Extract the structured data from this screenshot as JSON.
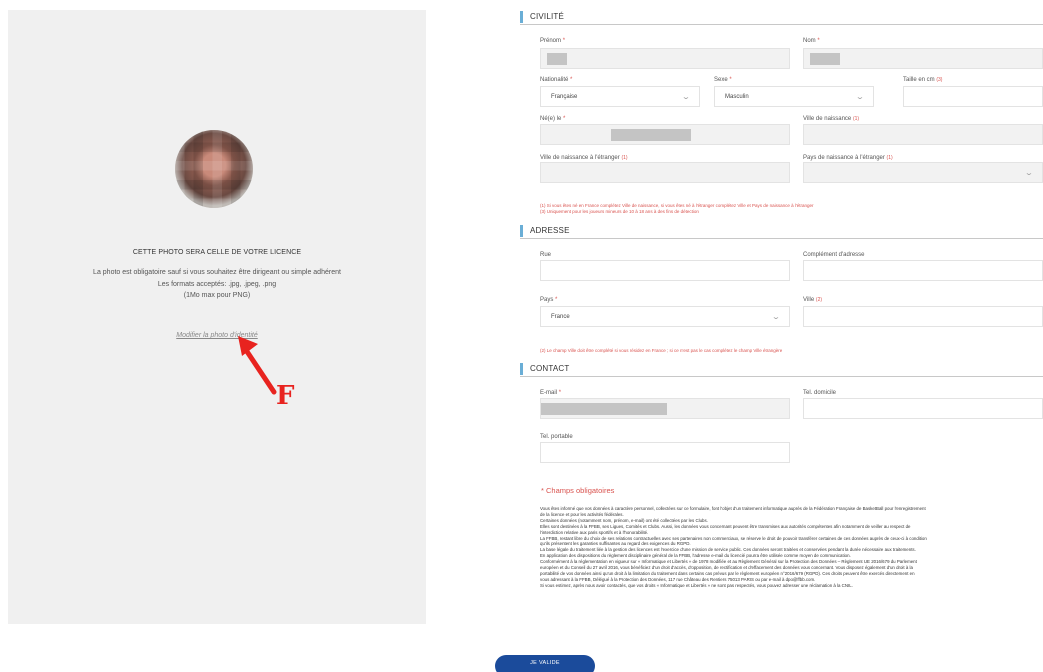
{
  "photo_panel": {
    "title": "CETTE PHOTO SERA CELLE DE VOTRE LICENCE",
    "desc_lines": [
      "La photo est obligatoire sauf si vous souhaitez être dirigeant ou simple adhérent",
      "Les formats acceptés: .jpg, .jpeg, .png",
      "(1Mo max pour PNG)"
    ],
    "link": "Modifier la photo d'identité",
    "annotation_letter": "F",
    "annotation_color": "#e8231f"
  },
  "civilite": {
    "title": "CIVILITÉ",
    "prenom_label": "Prénom",
    "nom_label": "Nom",
    "nationalite_label": "Nationalité",
    "nationalite_value": "Française",
    "sexe_label": "Sexe",
    "sexe_value": "Masculin",
    "taille_label": "Taille en cm",
    "taille_ref": "(3)",
    "ne_le_label": "Né(e) le",
    "ville_naissance_label": "Ville de naissance",
    "ville_naissance_ref": "(1)",
    "ville_etranger_label": "Ville de naissance à l'étranger",
    "ville_etranger_ref": "(1)",
    "pays_etranger_label": "Pays de naissance à l'étranger",
    "pays_etranger_ref": "(1)",
    "notes": [
      "(1) Si vous êtes né en France complétez Ville de naissance, si vous êtes né à l'étranger complétez Ville et Pays de naissance à l'étranger",
      "(3) Uniquement pour les joueurs mineurs de 10 à 18 ans à des fins de détection"
    ]
  },
  "adresse": {
    "title": "ADRESSE",
    "rue_label": "Rue",
    "complement_label": "Complément d'adresse",
    "pays_label": "Pays",
    "pays_value": "France",
    "ville_label": "Ville",
    "ville_ref": "(2)",
    "note": "(2) Le champ Ville doit être complété si vous résidez en France ; si ce n'est pas le cas complétez le champ Ville étrangère"
  },
  "contact": {
    "title": "CONTACT",
    "email_label": "E-mail",
    "tel_domicile_label": "Tel. domicile",
    "tel_portable_label": "Tel. portable"
  },
  "required_note": "* Champs obligatoires",
  "legal_lines": [
    "Vous êtes informé que vos données à caractère personnel, collectées sur ce formulaire, font l'objet d'un traitement informatique auprès de la Fédération Française de BasketBall pour l'enregistrement",
    "de la licence et pour les activités fédérales.",
    "Certaines données (notamment nom, prénom, e-mail) ont été collectées par les Clubs.",
    "Elles sont destinées à la FFBB, ses Ligues, Comités et Clubs. Aussi, les données vous concernant peuvent être transmises aux autorités compétentes afin notamment de veiller au respect de",
    "l'interdiction relative aux paris sportifs et à l'honorabilité.",
    "La FFBB, restant libre du choix de ses relations contractuelles avec ses partenaires non commerciaux, se réserve le droit de pouvoir transférer certaines de ces données auprès de ceux-ci à condition",
    "qu'ils présentent les garanties suffisantes au regard des exigences du RGPD.",
    "La base légale du traitement liée à la gestion des licences est l'exercice d'une mission de service public. Ces données seront traitées et conservées pendant la durée nécessaire aux traitements.",
    "En application des dispositions du règlement disciplinaire général de la FFBB, l'adresse e-mail du licencié pourra être utilisée comme moyen de communication.",
    "Conformément à la réglementation en vigueur sur « Informatique et Libertés » de 1978 modifiée et au Règlement Général sur la Protection des Données – Règlement UE 2016/679 du Parlement",
    "européen et du Conseil du 27 avril 2016, vous bénéficiez d'un droit d'accès, d'opposition, de rectification et d'effacement des données vous concernant. Vous disposez également d'un droit à la",
    "portabilité de vos données ainsi qu'un droit à la limitation du traitement dans certains cas prévus par le règlement européen n°2016/679 (RGPD). Ces droits peuvent être exercés directement en",
    "vous adressant à la FFBB, Délégué à la Protection des Données, 117 rue Château des Rentiers 75013 PARIS ou par e-mail à dpo@ffbb.com.",
    "Si vous estimez, après nous avoir contactés, que vos droits « Informatique et Libertés » ne sont pas respectés, vous pouvez adresser une réclamation à la CNIL."
  ],
  "validate_label": "JE VALIDE",
  "colors": {
    "accent_bar": "#6aaed6",
    "button": "#1b4b9b",
    "required": "#d9534f"
  }
}
